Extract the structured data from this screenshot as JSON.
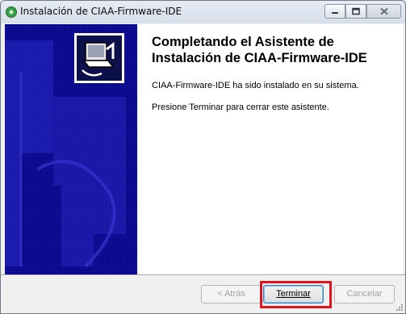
{
  "window": {
    "title": "Instalación de CIAA-Firmware-IDE"
  },
  "wizard": {
    "headline": "Completando el Asistente de Instalación de CIAA-Firmware-IDE",
    "paragraph1": "CIAA-Firmware-IDE ha sido instalado en su sistema.",
    "paragraph2": "Presione Terminar para cerrar este asistente."
  },
  "buttons": {
    "back": "< Atrás",
    "finish": "Terminar",
    "cancel": "Cancelar"
  },
  "colors": {
    "sidebar": "#0a0a8c",
    "highlight": "#e0141e"
  }
}
